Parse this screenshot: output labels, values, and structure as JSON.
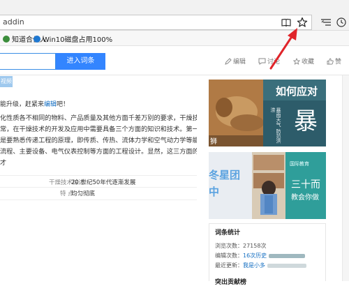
{
  "browser": {
    "address_text": "addin",
    "favorites": [
      {
        "label": "知道合伙人",
        "color": "#3b8d3b"
      },
      {
        "label": "Win10磁盘占用100%",
        "color": "#1f78d1"
      }
    ],
    "icons": [
      "reading-view-icon",
      "favorite-star-icon",
      "hub-icon",
      "history-icon"
    ]
  },
  "header": {
    "search_button": "进入词条",
    "actions": [
      {
        "label": "编辑",
        "icon": "pencil-icon"
      },
      {
        "label": "讨论",
        "icon": "chat-icon"
      },
      {
        "label": "收藏",
        "icon": "star-icon"
      },
      {
        "label": "赞",
        "icon": "thumb-up-icon"
      }
    ]
  },
  "article": {
    "video_tag": "视频",
    "upgrade_note": "能升级，赶紧来",
    "upgrade_link": "编辑",
    "upgrade_tail": "吧！",
    "paragraph_lines": [
      "化性质各不相同的物料、产品质量及其他方面千差万别的要求，干燥技术",
      "常，在干燥技术的开发及应用中需要具备三个方面的知识和技术。第一是",
      "是要熟悉传递工程的原理，即传质、传热、流体力学和空气动力学等能",
      "流程、主要设备、电气仪表控制等方面的工程设计。显然，这三方面的知",
      "才"
    ],
    "info": [
      {
        "key": "干燥技术综述",
        "value": "20 世纪50年代逐渐发展"
      },
      {
        "key": "特  点",
        "value": "均匀彻底"
      }
    ]
  },
  "sidebar": {
    "banner1": {
      "title": "如何应对",
      "big": "暴",
      "sub": "暴雨天气 防范洪涝",
      "side": "狮"
    },
    "banner2": {
      "left": "冬星团",
      "left2": "中",
      "brand": "国际教育",
      "right": "三十而",
      "right2": "教会你做"
    },
    "stats": {
      "title": "词条统计",
      "views_label": "浏览次数：",
      "views_value": "27158次",
      "edits_label": "编辑次数：",
      "edits_value": "16次历史",
      "updated_label": "最近更新：",
      "updated_value": "我是小多"
    },
    "section2_title": "突出贡献榜"
  },
  "colors": {
    "accent": "#3385ff",
    "annotation": "#e0242a",
    "link": "#136ec2"
  }
}
